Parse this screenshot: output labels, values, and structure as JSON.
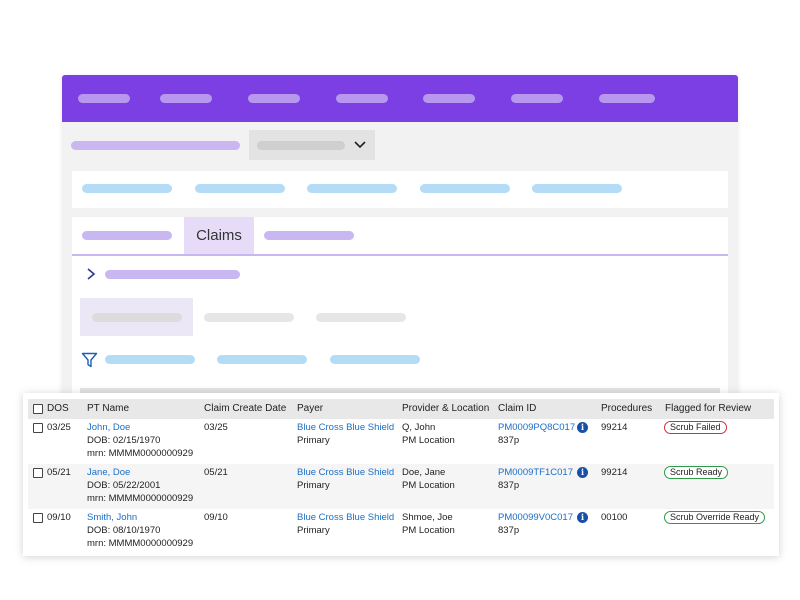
{
  "colors": {
    "nav_bg": "#7b3fe4",
    "placeholder_lavender": "#c9b7f2",
    "placeholder_blue": "#b5dcf7",
    "link": "#1a6fc6",
    "badge_failed": "#d0303a",
    "badge_ready": "#2e9a4a"
  },
  "tabs": {
    "active_label": "Claims"
  },
  "icons": {
    "chevron_down": "chevron-down-icon",
    "chevron_right": "chevron-right-icon",
    "filter": "filter-icon",
    "info": "info-icon"
  },
  "table": {
    "headers": {
      "dos": "DOS",
      "pt_name": "PT Name",
      "create_date": "Claim Create Date",
      "payer": "Payer",
      "provider": "Provider & Location",
      "claim_id": "Claim ID",
      "procedures": "Procedures",
      "flagged": "Flagged for Review"
    },
    "rows": [
      {
        "dos": "03/25",
        "name": "John, Doe",
        "dob": "DOB: 02/15/1970",
        "mrn": "mrn: MMMM0000000929",
        "create_date": "03/25",
        "payer": "Blue Cross Blue Shield",
        "payer_type": "Primary",
        "provider": "Q, John",
        "location": "PM Location",
        "claim_id": "PM0009PQ8C017",
        "claim_type": "837p",
        "procedure": "99214",
        "flag": "Scrub Failed"
      },
      {
        "dos": "05/21",
        "name": "Jane, Doe",
        "dob": "DOB: 05/22/2001",
        "mrn": "mrn: MMMM0000000929",
        "create_date": "05/21",
        "payer": "Blue Cross Blue Shield",
        "payer_type": "Primary",
        "provider": "Doe, Jane",
        "location": "PM Location",
        "claim_id": "PM0009TF1C017",
        "claim_type": "837p",
        "procedure": "99214",
        "flag": "Scrub Ready"
      },
      {
        "dos": "09/10",
        "name": "Smith, John",
        "dob": "DOB: 08/10/1970",
        "mrn": "mrn: MMMM0000000929",
        "create_date": "09/10",
        "payer": "Blue Cross Blue Shield",
        "payer_type": "Primary",
        "provider": "Shmoe, Joe",
        "location": "PM Location",
        "claim_id": "PM00099V0C017",
        "claim_type": "837p",
        "procedure": "00100",
        "flag": "Scrub Override Ready"
      }
    ]
  }
}
